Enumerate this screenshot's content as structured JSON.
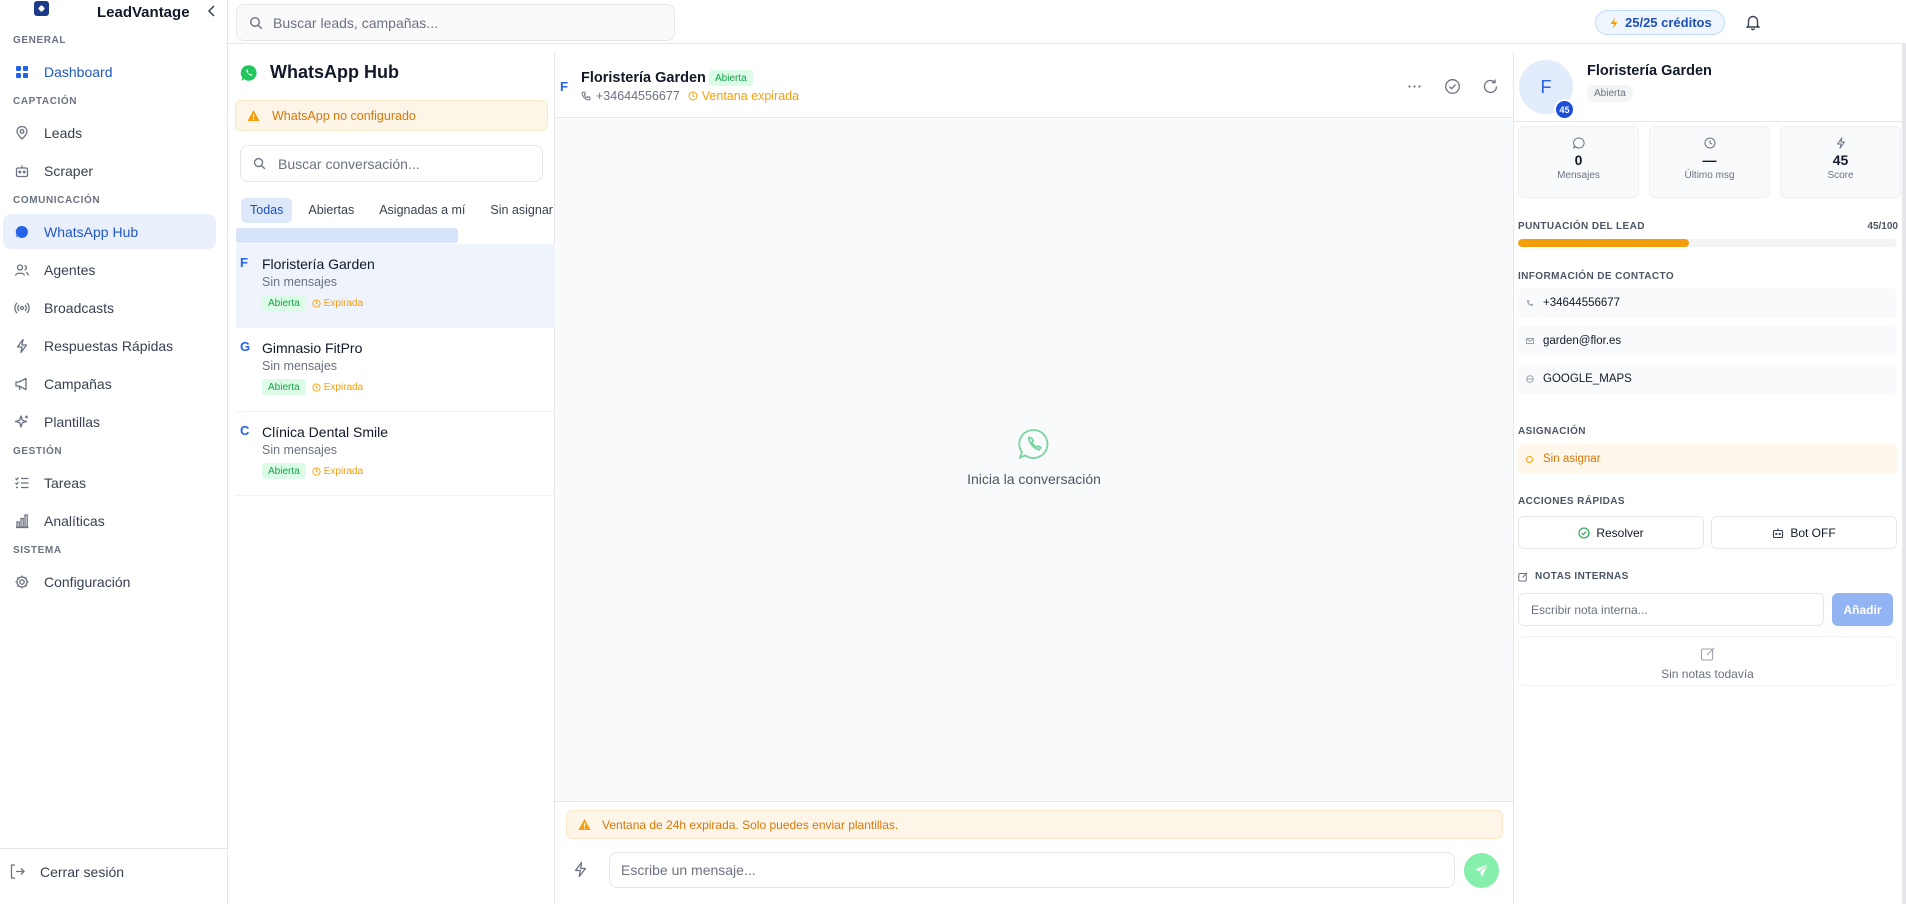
{
  "brand": {
    "name": "LeadVantage"
  },
  "sidebar": {
    "sections": [
      {
        "label": "GENERAL"
      },
      {
        "label": "CAPTACIÓN"
      },
      {
        "label": "COMUNICACIÓN"
      },
      {
        "label": "GESTIÓN"
      },
      {
        "label": "SISTEMA"
      }
    ],
    "items": [
      {
        "label": "Dashboard",
        "icon": "grid-icon"
      },
      {
        "label": "Leads",
        "icon": "map-pin-icon"
      },
      {
        "label": "Scraper",
        "icon": "bot-icon"
      },
      {
        "label": "WhatsApp Hub",
        "icon": "chat-bubble-icon",
        "active": true
      },
      {
        "label": "Agentes",
        "icon": "users-icon"
      },
      {
        "label": "Broadcasts",
        "icon": "radio-icon"
      },
      {
        "label": "Respuestas Rápidas",
        "icon": "zap-icon"
      },
      {
        "label": "Campañas",
        "icon": "megaphone-icon"
      },
      {
        "label": "Plantillas",
        "icon": "sparkles-icon"
      },
      {
        "label": "Tareas",
        "icon": "list-checks-icon"
      },
      {
        "label": "Analíticas",
        "icon": "bar-chart-icon"
      },
      {
        "label": "Configuración",
        "icon": "gear-icon"
      }
    ],
    "logout_label": "Cerrar sesión"
  },
  "topbar": {
    "search_placeholder": "Buscar leads, campañas...",
    "credits_label": "25/25 créditos"
  },
  "hub": {
    "title": "WhatsApp Hub",
    "warning": "WhatsApp no configurado",
    "search_placeholder": "Buscar conversación...",
    "tabs": [
      {
        "label": "Todas",
        "active": true
      },
      {
        "label": "Abiertas"
      },
      {
        "label": "Asignadas a mí"
      },
      {
        "label": "Sin asignar"
      }
    ],
    "conversations": [
      {
        "initial": "F",
        "name": "Floristería Garden",
        "subtitle": "Sin mensajes",
        "status": "Abierta",
        "window": "Expirada",
        "selected": true
      },
      {
        "initial": "G",
        "name": "Gimnasio FitPro",
        "subtitle": "Sin mensajes",
        "status": "Abierta",
        "window": "Expirada"
      },
      {
        "initial": "C",
        "name": "Clínica Dental Smile",
        "subtitle": "Sin mensajes",
        "status": "Abierta",
        "window": "Expirada"
      }
    ]
  },
  "chat": {
    "initial": "F",
    "name": "Floristería Garden",
    "status": "Abierta",
    "phone": "+34644556677",
    "window_status": "Ventana expirada",
    "empty_text": "Inicia la conversación",
    "expired_banner": "Ventana de 24h expirada. Solo puedes enviar plantillas.",
    "input_placeholder": "Escribe un mensaje..."
  },
  "contact": {
    "initial": "F",
    "score_badge": "45",
    "name": "Floristería Garden",
    "status": "Abierta",
    "stats": [
      {
        "value": "0",
        "label": "Mensajes",
        "icon": "message-circle-icon"
      },
      {
        "value": "—",
        "label": "Último msg",
        "icon": "clock-icon"
      },
      {
        "value": "45",
        "label": "Score",
        "icon": "zap-icon"
      }
    ],
    "score_section_label": "PUNTUACIÓN DEL LEAD",
    "score_text": "45/100",
    "score_fraction": 0.45,
    "contact_section_label": "INFORMACIÓN DE CONTACTO",
    "phone": "+34644556677",
    "email": "garden@flor.es",
    "source": "GOOGLE_MAPS",
    "assign_section_label": "ASIGNACIÓN",
    "assignment": "Sin asignar",
    "actions_section_label": "ACCIONES RÁPIDAS",
    "resolve_label": "Resolver",
    "bot_label": "Bot OFF",
    "notes_section_label": "NOTAS INTERNAS",
    "note_placeholder": "Escribir nota interna...",
    "add_note_label": "Añadir",
    "no_notes_text": "Sin notas todavía"
  },
  "colors": {
    "accent": "#2563eb",
    "active_nav_bg": "#eaf0fb",
    "whatsapp_green": "#22c55e",
    "warning": "#f59e0b",
    "open_badge_bg": "#dcfce7",
    "open_badge_text": "#16a34a"
  }
}
